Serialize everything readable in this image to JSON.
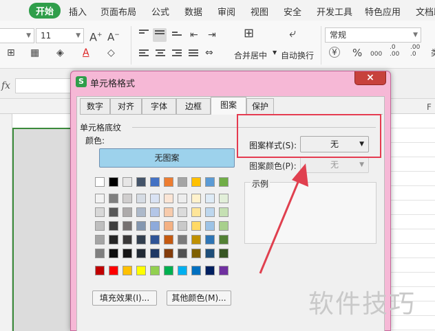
{
  "ribbon_tabs": [
    "开始",
    "插入",
    "页面布局",
    "公式",
    "数据",
    "审阅",
    "视图",
    "安全",
    "开发工具",
    "特色应用",
    "文档助"
  ],
  "ribbon": {
    "font_size": "11",
    "font_size_up": "A",
    "font_size_down": "A",
    "merge_center": "合并居中",
    "wrap_text": "自动换行",
    "number_format": "常规",
    "percent": "%",
    "currency": "¥",
    "thousands": "000",
    "dec_inc": ".0\n.00",
    "dec_dec": ".00\n.0",
    "cut_off": "类"
  },
  "formula_bar": {
    "fx": "fx"
  },
  "sheet": {
    "column_F": "F"
  },
  "dialog": {
    "title": "单元格格式",
    "logo": "S",
    "close": "×",
    "tabs": [
      "数字",
      "对齐",
      "字体",
      "边框",
      "图案",
      "保护"
    ],
    "active_tab": "图案",
    "group_title": "单元格底纹",
    "color_label": "颜色:",
    "no_pattern_button": "无图案",
    "pattern_style_label": "图案样式(S):",
    "pattern_style_value": "无",
    "pattern_color_label": "图案颜色(P):",
    "pattern_color_value": "无",
    "sample_label": "示例",
    "fill_effects_button": "填充效果(I)...",
    "more_colors_button": "其他颜色(M)...",
    "palette": {
      "theme_top": [
        "#ffffff",
        "#000000",
        "#e7e6e6",
        "#44546a",
        "#4472c4",
        "#ed7d31",
        "#a5a5a5",
        "#ffc000",
        "#5b9bd5",
        "#70ad47"
      ],
      "theme_rows": [
        [
          "#f2f2f2",
          "#7f7f7f",
          "#d0cece",
          "#d6dce4",
          "#d9e2f3",
          "#fbe5d5",
          "#ededed",
          "#fff2cc",
          "#deebf6",
          "#e2efd9"
        ],
        [
          "#d8d8d8",
          "#595959",
          "#aeabab",
          "#adb9ca",
          "#b4c6e7",
          "#f7cbac",
          "#dbdbdb",
          "#fee599",
          "#bdd7ee",
          "#c5e0b3"
        ],
        [
          "#bfbfbf",
          "#3f3f3f",
          "#767171",
          "#8497b0",
          "#8eaadb",
          "#f4b183",
          "#c9c9c9",
          "#ffd966",
          "#9dc3e6",
          "#a8d08d"
        ],
        [
          "#a5a5a5",
          "#262626",
          "#3a3838",
          "#323f4f",
          "#2f5496",
          "#c55a11",
          "#7b7b7b",
          "#bf9000",
          "#2e75b5",
          "#538135"
        ],
        [
          "#7f7f7f",
          "#0c0c0c",
          "#171616",
          "#222a35",
          "#1e3864",
          "#833c0b",
          "#525252",
          "#7f6000",
          "#1e4e79",
          "#375623"
        ]
      ],
      "standard": [
        "#c00000",
        "#ff0000",
        "#ffc000",
        "#ffff00",
        "#92d050",
        "#00b050",
        "#00b0f0",
        "#0070c0",
        "#002060",
        "#7030a0"
      ]
    }
  },
  "watermark": "软件技巧",
  "colors": {
    "accent_green": "#2f9e4a",
    "highlight_red": "#e53a4f",
    "dialog_frame": "#f6b8d6"
  }
}
